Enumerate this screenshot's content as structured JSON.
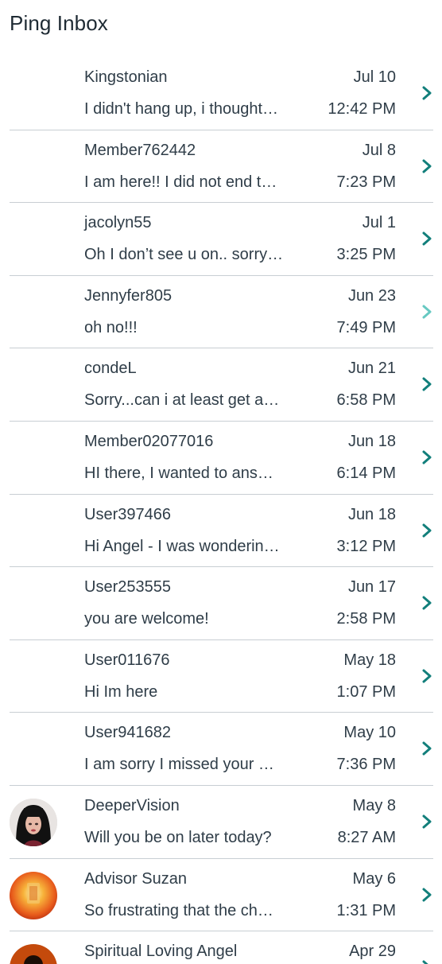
{
  "header": {
    "title": "Ping Inbox"
  },
  "colors": {
    "chevron": "#127f7b",
    "chevron_light": "#67c9c2",
    "divider": "#c8ced3"
  },
  "messages": [
    {
      "name": "Kingstonian",
      "preview": "I didn't hang up, i thought…",
      "date": "Jul 10",
      "time": "12:42 PM",
      "avatar": "",
      "chevron": "chevron-right-icon"
    },
    {
      "name": "Member762442",
      "preview": "I am here!! I did not end t…",
      "date": "Jul 8",
      "time": "7:23 PM",
      "avatar": "",
      "chevron": "chevron-right-icon"
    },
    {
      "name": "jacolyn55",
      "preview": "Oh I don’t see u on.. sorry…",
      "date": "Jul 1",
      "time": "3:25 PM",
      "avatar": "",
      "chevron": "chevron-right-icon"
    },
    {
      "name": "Jennyfer805",
      "preview": "oh no!!!",
      "date": "Jun 23",
      "time": "7:49 PM",
      "avatar": "",
      "chevron": "chevron-right-icon"
    },
    {
      "name": "condeL",
      "preview": "Sorry...can i at least get a…",
      "date": "Jun 21",
      "time": "6:58 PM",
      "avatar": "",
      "chevron": "chevron-right-icon"
    },
    {
      "name": "Member02077016",
      "preview": "HI there, I wanted to ans…",
      "date": "Jun 18",
      "time": "6:14 PM",
      "avatar": "",
      "chevron": "chevron-right-icon"
    },
    {
      "name": "User397466",
      "preview": "Hi Angel - I was wonderin…",
      "date": "Jun 18",
      "time": "3:12 PM",
      "avatar": "",
      "chevron": "chevron-right-icon"
    },
    {
      "name": "User253555",
      "preview": "you are welcome!",
      "date": "Jun 17",
      "time": "2:58 PM",
      "avatar": "",
      "chevron": "chevron-right-icon"
    },
    {
      "name": "User011676",
      "preview": "Hi Im here",
      "date": "May 18",
      "time": "1:07 PM",
      "avatar": "",
      "chevron": "chevron-right-icon"
    },
    {
      "name": "User941682",
      "preview": "I am sorry I missed your …",
      "date": "May 10",
      "time": "7:36 PM",
      "avatar": "",
      "chevron": "chevron-right-icon"
    },
    {
      "name": "DeeperVision",
      "preview": "Will you be on later today?",
      "date": "May 8",
      "time": "8:27 AM",
      "avatar": "woman-portrait-avatar",
      "chevron": "chevron-right-icon"
    },
    {
      "name": "Advisor Suzan",
      "preview": "So frustrating that the ch…",
      "date": "May 6",
      "time": "1:31 PM",
      "avatar": "orange-glow-avatar",
      "chevron": "chevron-right-icon"
    },
    {
      "name": "Spiritual Loving Angel",
      "preview": "",
      "date": "Apr 29",
      "time": "",
      "avatar": "silhouette-avatar",
      "chevron": "chevron-right-icon"
    }
  ]
}
